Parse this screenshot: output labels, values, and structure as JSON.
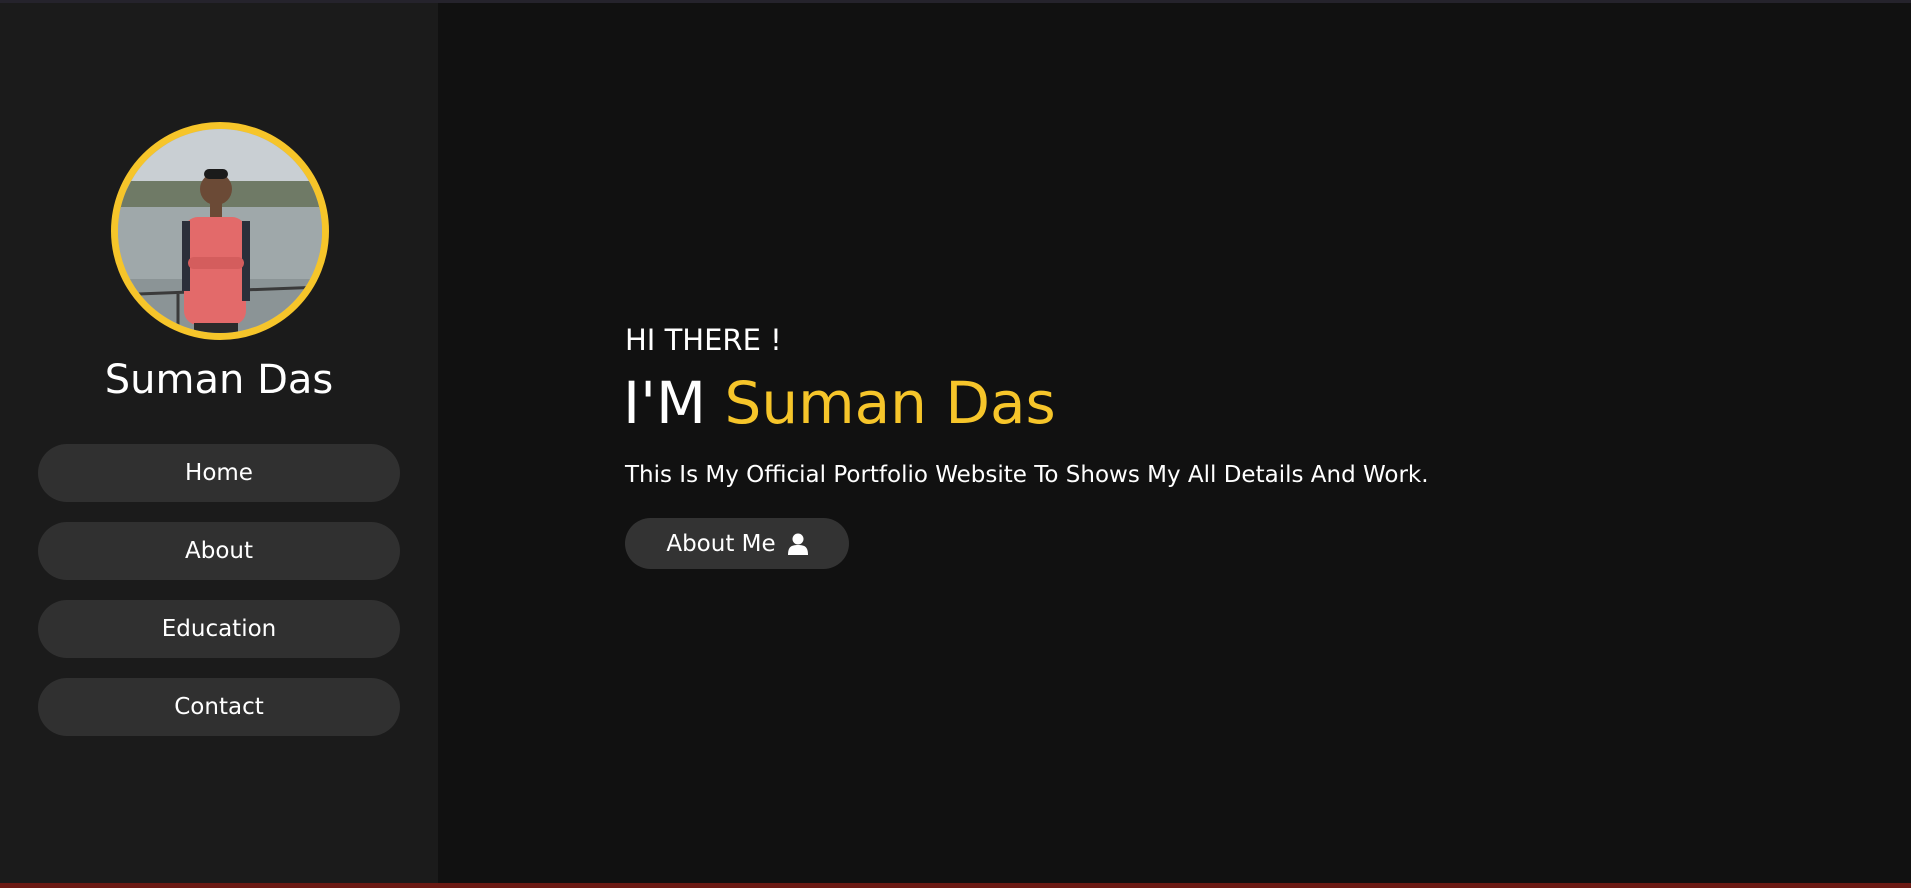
{
  "sidebar": {
    "name": "Suman Das",
    "nav": [
      {
        "label": "Home"
      },
      {
        "label": "About"
      },
      {
        "label": "Education"
      },
      {
        "label": "Contact"
      }
    ]
  },
  "hero": {
    "greeting": "HI THERE !",
    "title_prefix": "I'M ",
    "title_name": "Suman Das",
    "description": "This Is My Official Portfolio Website To Shows My All Details And Work.",
    "cta_label": "About Me",
    "cta_icon": "user-icon"
  },
  "colors": {
    "accent": "#f6c52a",
    "background": "#111111",
    "sidebar": "#1b1b1b",
    "button": "#303030"
  }
}
